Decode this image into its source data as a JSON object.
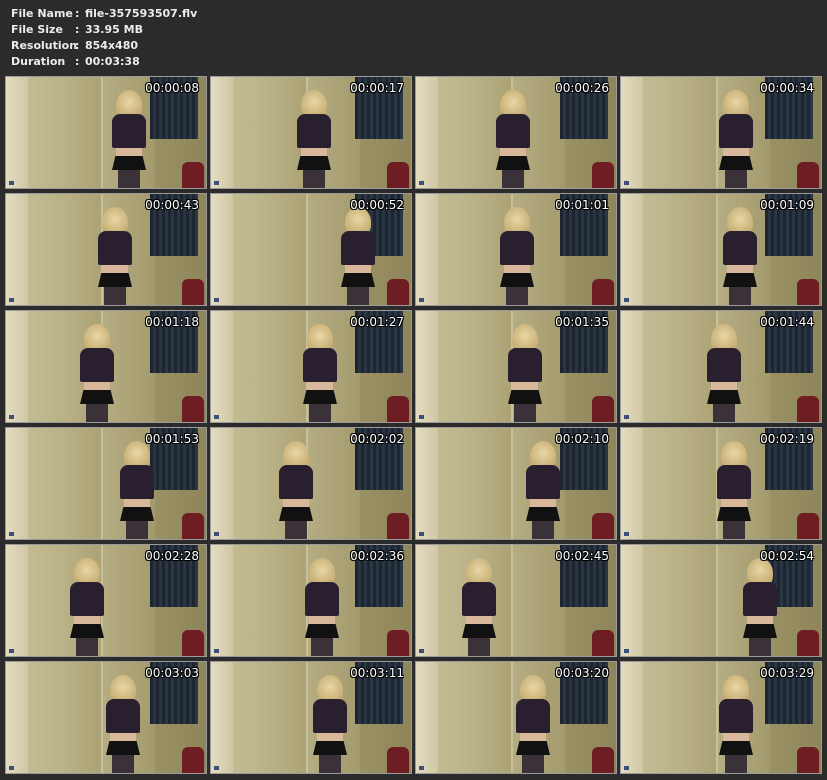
{
  "file_info": [
    {
      "label": "File Name",
      "sep": ":",
      "value": "file-357593507.flv"
    },
    {
      "label": "File Size",
      "sep": ":",
      "value": "33.95 MB"
    },
    {
      "label": "Resolution",
      "sep": ":",
      "value": "854x480"
    },
    {
      "label": "Duration",
      "sep": ":",
      "value": "00:03:38"
    }
  ],
  "thumbnails": [
    {
      "time": "00:00:08"
    },
    {
      "time": "00:00:17"
    },
    {
      "time": "00:00:26"
    },
    {
      "time": "00:00:34"
    },
    {
      "time": "00:00:43"
    },
    {
      "time": "00:00:52"
    },
    {
      "time": "00:01:01"
    },
    {
      "time": "00:01:09"
    },
    {
      "time": "00:01:18"
    },
    {
      "time": "00:01:27"
    },
    {
      "time": "00:01:35"
    },
    {
      "time": "00:01:44"
    },
    {
      "time": "00:01:53"
    },
    {
      "time": "00:02:02"
    },
    {
      "time": "00:02:10"
    },
    {
      "time": "00:02:19"
    },
    {
      "time": "00:02:28"
    },
    {
      "time": "00:02:36"
    },
    {
      "time": "00:02:45"
    },
    {
      "time": "00:02:54"
    },
    {
      "time": "00:03:03"
    },
    {
      "time": "00:03:11"
    },
    {
      "time": "00:03:20"
    },
    {
      "time": "00:03:29"
    }
  ]
}
